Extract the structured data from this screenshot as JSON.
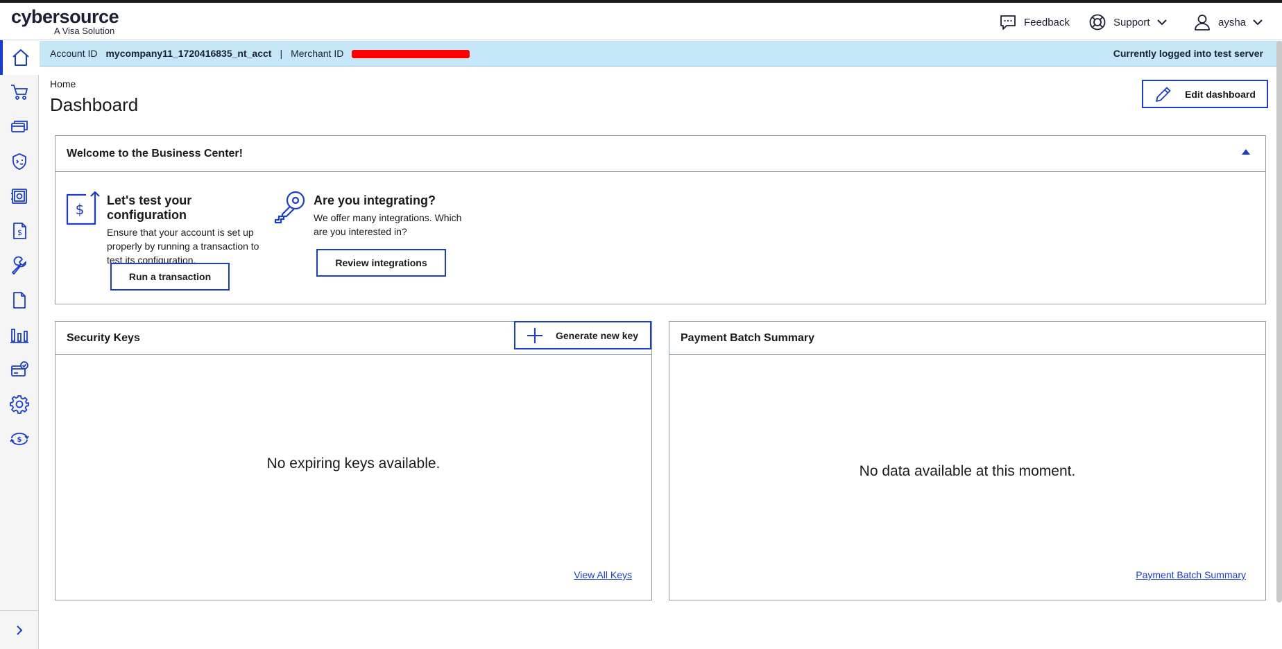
{
  "brand": {
    "name": "cybersource",
    "tagline": "A Visa Solution"
  },
  "header": {
    "feedback_label": "Feedback",
    "support_label": "Support",
    "user_name": "aysha"
  },
  "sidebar": {
    "items": [
      {
        "icon": "home-icon",
        "active": true
      },
      {
        "icon": "cart-icon",
        "active": false
      },
      {
        "icon": "cards-icon",
        "active": false
      },
      {
        "icon": "shield-icon",
        "active": false
      },
      {
        "icon": "safe-icon",
        "active": false
      },
      {
        "icon": "invoice-icon",
        "active": false
      },
      {
        "icon": "wrench-icon",
        "active": false
      },
      {
        "icon": "document-icon",
        "active": false
      },
      {
        "icon": "reports-icon",
        "active": false
      },
      {
        "icon": "card-check-icon",
        "active": false
      },
      {
        "icon": "gear-icon",
        "active": false
      },
      {
        "icon": "currency-exchange-icon",
        "active": false
      }
    ],
    "expand_icon": "chevron-right-icon"
  },
  "infobar": {
    "account_label": "Account ID",
    "account_value": "mycompany11_1720416835_nt_acct",
    "separator": "|",
    "merchant_label": "Merchant ID",
    "server_status": "Currently logged into test server"
  },
  "page": {
    "breadcrumb": "Home",
    "title": "Dashboard",
    "edit_label": "Edit dashboard"
  },
  "welcome": {
    "title": "Welcome to the Business Center!",
    "test_card": {
      "title": "Let's test your configuration",
      "line1": "Ensure that your account is set up",
      "line2": "properly by running a transaction to",
      "line3": "test its configuration.",
      "button": "Run a transaction"
    },
    "integrate_card": {
      "title": "Are you integrating?",
      "line1": "We offer many integrations. Which",
      "line2": "are you interested in?",
      "button": "Review integrations"
    }
  },
  "security_keys": {
    "title": "Security Keys",
    "generate_label": "Generate new key",
    "empty": "No expiring keys available.",
    "link": "View All Keys"
  },
  "batch_summary": {
    "title": "Payment Batch Summary",
    "empty": "No data available at this moment.",
    "link": "Payment Batch Summary"
  },
  "colors": {
    "accent": "#1a3bd1",
    "infobar_bg": "#c6e7f8",
    "redaction": "#ff0000"
  }
}
